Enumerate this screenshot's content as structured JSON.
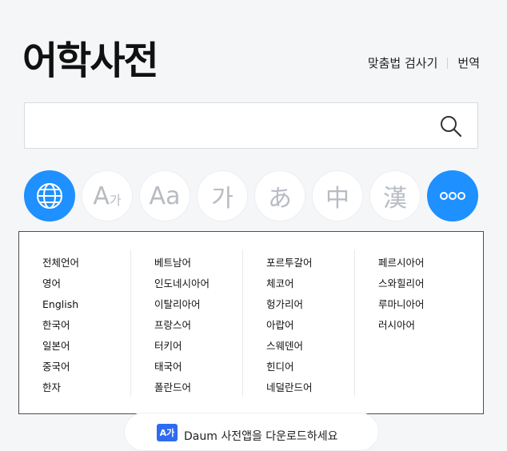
{
  "header": {
    "title": "어학사전"
  },
  "toplinks": {
    "spell_check": "맞춤법 검사기",
    "translate": "번역"
  },
  "search": {
    "placeholder": ""
  },
  "lang_buttons": {
    "ko_en": {
      "big": "A",
      "small": "가"
    },
    "en": "Aa",
    "ko": "가",
    "ja": "あ",
    "zh": "中",
    "hanja": "漢"
  },
  "language_panel": {
    "columns": [
      [
        "전체언어",
        "영어",
        "English",
        "한국어",
        "일본어",
        "중국어",
        "한자"
      ],
      [
        "베트남어",
        "인도네시아어",
        "이탈리아어",
        "프랑스어",
        "터키어",
        "태국어",
        "폴란드어"
      ],
      [
        "포르투갈어",
        "체코어",
        "헝가리어",
        "아랍어",
        "스웨덴어",
        "힌디어",
        "네덜란드어"
      ],
      [
        "페르시아어",
        "스와힐리어",
        "루마니아어",
        "러시아어"
      ]
    ]
  },
  "footer": {
    "badge": "A가",
    "text": "Daum 사전앱을 다운로드하세요"
  },
  "colors": {
    "accent": "#1e90ff",
    "panel_border": "#4a4d52"
  }
}
